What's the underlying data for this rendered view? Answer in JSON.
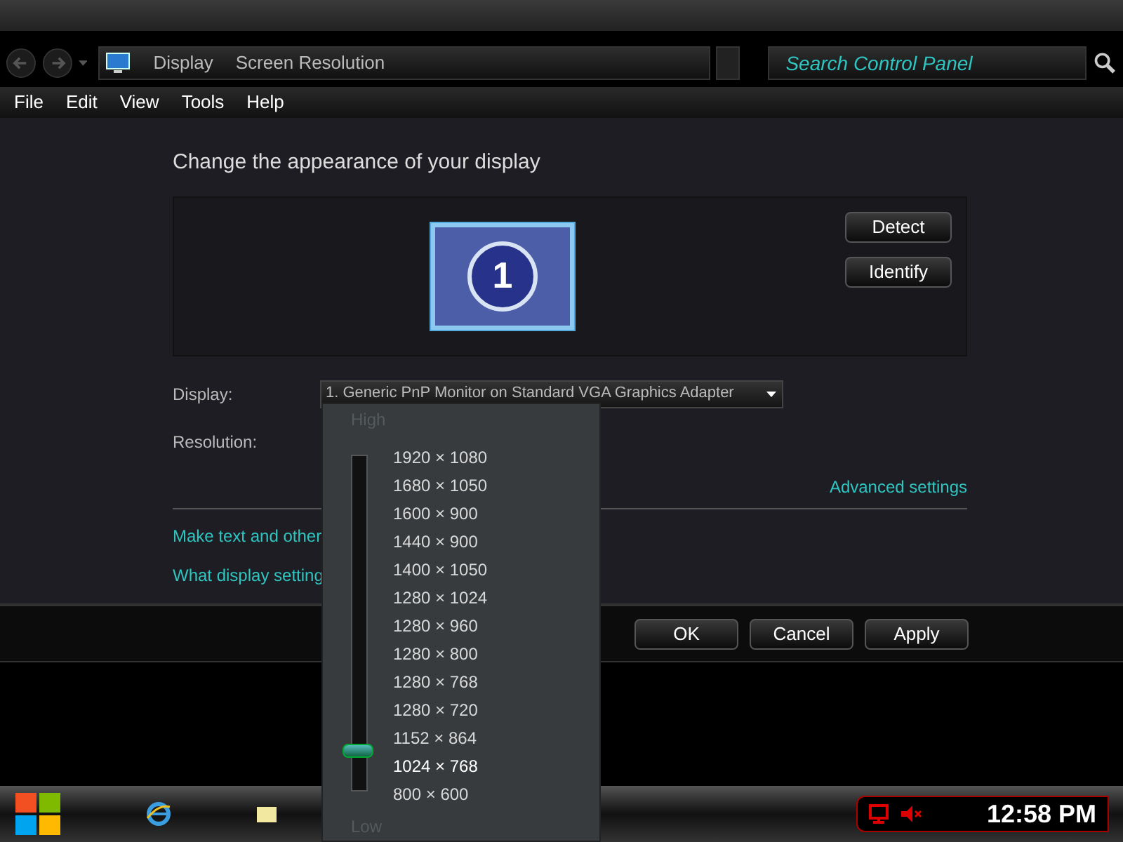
{
  "address_bar": {
    "crumbs": [
      "Display",
      "Screen Resolution"
    ]
  },
  "search": {
    "placeholder": "Search Control Panel"
  },
  "menu": [
    "File",
    "Edit",
    "View",
    "Tools",
    "Help"
  ],
  "heading": "Change the appearance of your display",
  "monitor": {
    "number": "1"
  },
  "side_buttons": [
    "Detect",
    "Identify"
  ],
  "display": {
    "label": "Display:",
    "value": "1. Generic PnP Monitor on Standard VGA Graphics Adapter"
  },
  "resolution": {
    "label": "Resolution:"
  },
  "advanced_link": "Advanced settings",
  "links": [
    "Make text and other",
    "What display setting"
  ],
  "buttons": [
    "OK",
    "Cancel",
    "Apply"
  ],
  "resolution_popup": {
    "high": "High",
    "low": "Low",
    "options": [
      {
        "label": "1920 × 1080",
        "selected": false
      },
      {
        "label": "1680 × 1050",
        "selected": false
      },
      {
        "label": "1600 × 900",
        "selected": false
      },
      {
        "label": "1440 × 900",
        "selected": false
      },
      {
        "label": "1400 × 1050",
        "selected": false
      },
      {
        "label": "1280 × 1024",
        "selected": false
      },
      {
        "label": "1280 × 960",
        "selected": false
      },
      {
        "label": "1280 × 800",
        "selected": false
      },
      {
        "label": "1280 × 768",
        "selected": false
      },
      {
        "label": "1280 × 720",
        "selected": false
      },
      {
        "label": "1152 × 864",
        "selected": false
      },
      {
        "label": "1024 × 768",
        "selected": true
      },
      {
        "label": "800 × 600",
        "selected": false
      }
    ]
  },
  "taskbar": {
    "clock": "12:58 PM"
  }
}
